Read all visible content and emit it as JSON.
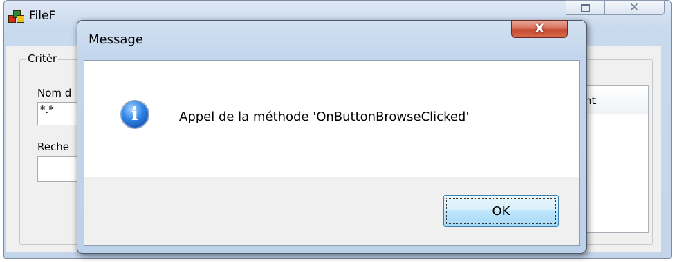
{
  "main_window": {
    "title": "FileF",
    "maximize_label": "",
    "close_label": "☒",
    "group_label": "Critèr",
    "name_label": "Nom d",
    "name_value": "*.*",
    "search_label": "Reche",
    "search_value": "",
    "list_column": "nt"
  },
  "dialog": {
    "title": "Message",
    "close_label": "X",
    "icon": "info-icon",
    "message": "Appel de la méthode 'OnButtonBrowseClicked'",
    "ok_label": "OK"
  }
}
